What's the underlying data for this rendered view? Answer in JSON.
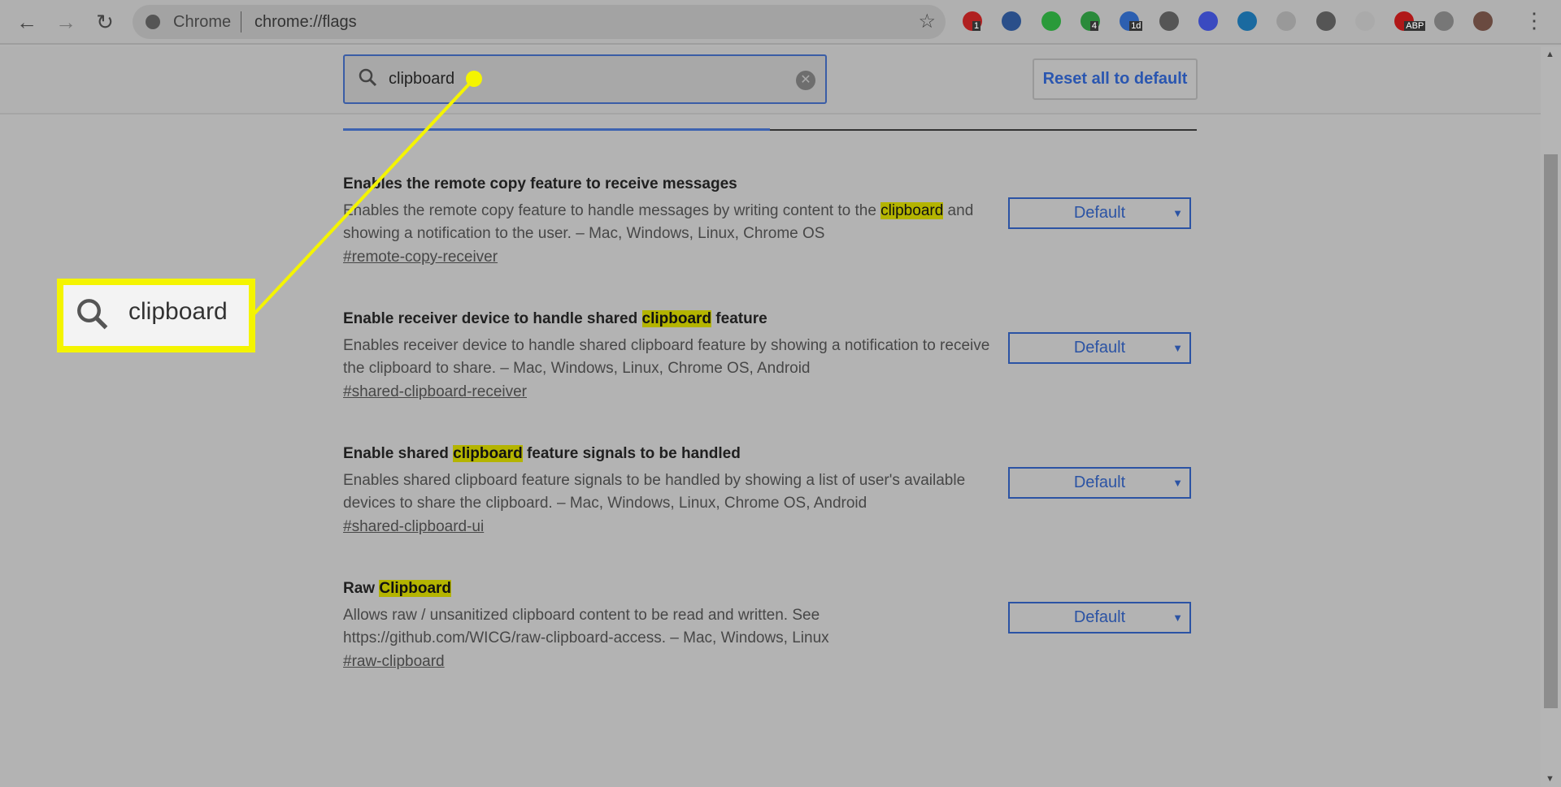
{
  "browser": {
    "site_label": "Chrome",
    "url": "chrome://flags",
    "extensions": [
      {
        "name": "todo-ext",
        "color": "#b02020",
        "badge": "1"
      },
      {
        "name": "y-ext",
        "color": "#2a4f8a"
      },
      {
        "name": "evernote-ext",
        "color": "#2a9a3a"
      },
      {
        "name": "green-ext",
        "color": "#2a8a3a",
        "badge": "4"
      },
      {
        "name": "calendar-ext",
        "color": "#2c5fb0",
        "badge": "1d"
      },
      {
        "name": "feather-ext",
        "color": "#555"
      },
      {
        "name": "v-ext",
        "color": "#3a4ac0"
      },
      {
        "name": "circle-ext",
        "color": "#1a6aa0"
      },
      {
        "name": "doc-ext",
        "color": "#999"
      },
      {
        "name": "grey-circle-ext",
        "color": "#555"
      },
      {
        "name": "pocket-ext",
        "color": "#aaa"
      },
      {
        "name": "abp-ext",
        "color": "#b01818",
        "badge": "ABP"
      },
      {
        "name": "robot-ext",
        "color": "#777"
      },
      {
        "name": "profile-avatar",
        "color": "#6a4a40"
      }
    ]
  },
  "search": {
    "value": "clipboard"
  },
  "reset_label": "Reset all to default",
  "highlight_color": "#b4b400",
  "flags": [
    {
      "title_pre": "Enables the remote copy feature to receive messages",
      "title_hl": "",
      "title_post": "",
      "desc_pre": "Enables the remote copy feature to handle messages by writing content to the ",
      "desc_hl": "clipboard",
      "desc_post": " and showing a notification to the user. – Mac, Windows, Linux, Chrome OS",
      "link": "#remote-copy-receiver",
      "value": "Default"
    },
    {
      "title_pre": "Enable receiver device to handle shared ",
      "title_hl": "clipboard",
      "title_post": " feature",
      "desc_pre": "Enables receiver device to handle shared clipboard feature by showing a notification to receive the clipboard to share. – Mac, Windows, Linux, Chrome OS, Android",
      "desc_hl": "",
      "desc_post": "",
      "link": "#shared-clipboard-receiver",
      "value": "Default"
    },
    {
      "title_pre": "Enable shared ",
      "title_hl": "clipboard",
      "title_post": " feature signals to be handled",
      "desc_pre": "Enables shared clipboard feature signals to be handled by showing a list of user's available devices to share the clipboard. – Mac, Windows, Linux, Chrome OS, Android",
      "desc_hl": "",
      "desc_post": "",
      "link": "#shared-clipboard-ui",
      "value": "Default"
    },
    {
      "title_pre": "Raw ",
      "title_hl": "Clipboard",
      "title_post": "",
      "desc_pre": "Allows raw / unsanitized clipboard content to be read and written. See https://github.com/WICG/raw-clipboard-access. – Mac, Windows, Linux",
      "desc_hl": "",
      "desc_post": "",
      "link": "#raw-clipboard",
      "value": "Default"
    }
  ],
  "callout": {
    "value": "clipboard",
    "color": "#f4f400"
  }
}
